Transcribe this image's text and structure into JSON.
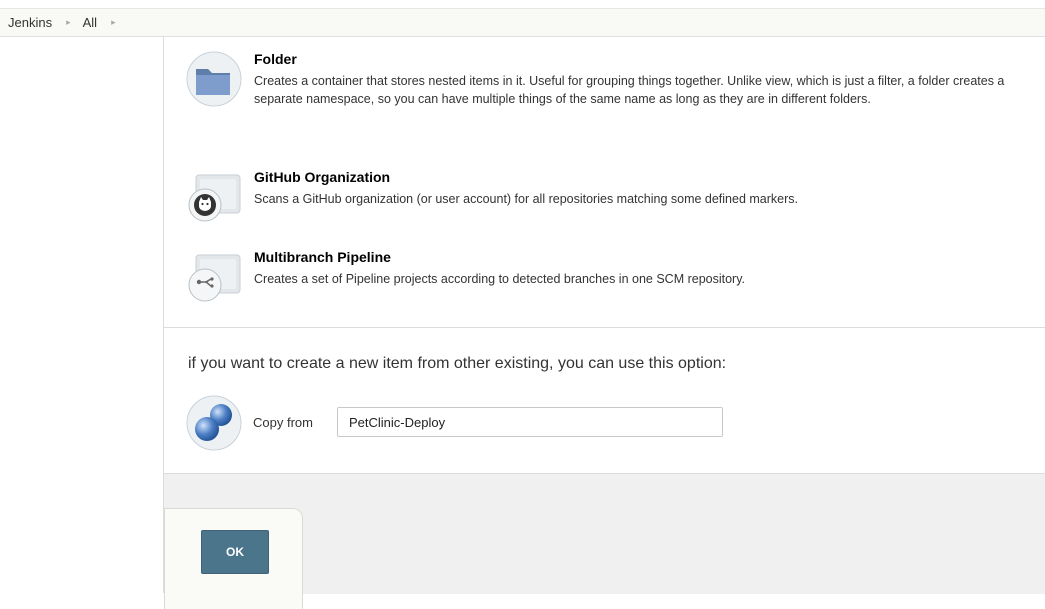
{
  "breadcrumb": {
    "items": [
      "Jenkins",
      "All"
    ],
    "separator": "▸"
  },
  "item_types": [
    {
      "icon": "folder-icon",
      "title": "Folder",
      "description": "Creates a container that stores nested items in it. Useful for grouping things together. Unlike view, which is just a filter, a folder creates a separate namespace, so you can have multiple things of the same name as long as they are in different folders."
    },
    {
      "icon": "github-organization-icon",
      "title": "GitHub Organization",
      "description": "Scans a GitHub organization (or user account) for all repositories matching some defined markers."
    },
    {
      "icon": "multibranch-pipeline-icon",
      "title": "Multibranch Pipeline",
      "description": "Creates a set of Pipeline projects according to detected branches in one SCM repository."
    }
  ],
  "copy": {
    "prompt": "if you want to create a new item from other existing, you can use this option:",
    "label": "Copy from",
    "value": "PetClinic-Deploy",
    "icon": "copy-item-icon"
  },
  "footer": {
    "ok_label": "OK"
  },
  "colors": {
    "ok_button": "#4b758b",
    "breadcrumb_bg": "#f9f9f6",
    "footer_bg": "#f0f0f0"
  }
}
